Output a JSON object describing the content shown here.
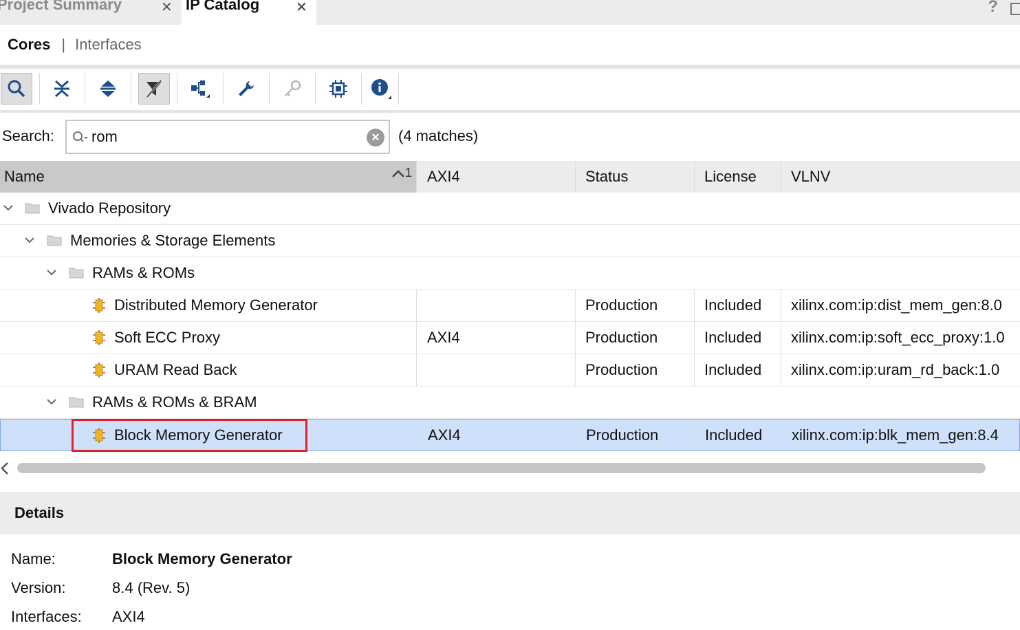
{
  "tabs": [
    {
      "label": "Project Summary",
      "close": "✕"
    },
    {
      "label": "IP Catalog",
      "close": "✕"
    }
  ],
  "help_label": "?",
  "subtabs": {
    "cores": "Cores",
    "separator": "|",
    "interfaces": "Interfaces"
  },
  "toolbar": {
    "icons": [
      "search-icon",
      "collapse-all-icon",
      "expand-all-icon",
      "filter-icon",
      "hierarchy-icon",
      "wrench-icon",
      "key-icon",
      "chip-icon",
      "info-icon"
    ]
  },
  "search": {
    "label": "Search:",
    "value": "rom",
    "matches": "(4 matches)"
  },
  "table": {
    "headers": {
      "name": "Name",
      "sort": "1",
      "axi": "AXI4",
      "status": "Status",
      "license": "License",
      "vlnv": "VLNV"
    },
    "rows": [
      {
        "name": "Vivado Repository",
        "axi": "",
        "status": "",
        "license": "",
        "vlnv": ""
      },
      {
        "name": "Memories & Storage Elements",
        "axi": "",
        "status": "",
        "license": "",
        "vlnv": ""
      },
      {
        "name": "RAMs & ROMs",
        "axi": "",
        "status": "",
        "license": "",
        "vlnv": ""
      },
      {
        "name": "Distributed Memory Generator",
        "axi": "",
        "status": "Production",
        "license": "Included",
        "vlnv": "xilinx.com:ip:dist_mem_gen:8.0"
      },
      {
        "name": "Soft ECC Proxy",
        "axi": "AXI4",
        "status": "Production",
        "license": "Included",
        "vlnv": "xilinx.com:ip:soft_ecc_proxy:1.0"
      },
      {
        "name": "URAM Read Back",
        "axi": "",
        "status": "Production",
        "license": "Included",
        "vlnv": "xilinx.com:ip:uram_rd_back:1.0"
      },
      {
        "name": "RAMs & ROMs & BRAM",
        "axi": "",
        "status": "",
        "license": "",
        "vlnv": ""
      },
      {
        "name": "Block Memory Generator",
        "axi": "AXI4",
        "status": "Production",
        "license": "Included",
        "vlnv": "xilinx.com:ip:blk_mem_gen:8.4"
      }
    ]
  },
  "details": {
    "title": "Details",
    "name_label": "Name:",
    "name_value": "Block Memory Generator",
    "version_label": "Version:",
    "version_value": "8.4 (Rev. 5)",
    "interfaces_label": "Interfaces:",
    "interfaces_value": "AXI4"
  },
  "colors": {
    "selection": "#cfe0fb",
    "highlight": "#e0202a",
    "ip_icon": "#f0b429"
  }
}
